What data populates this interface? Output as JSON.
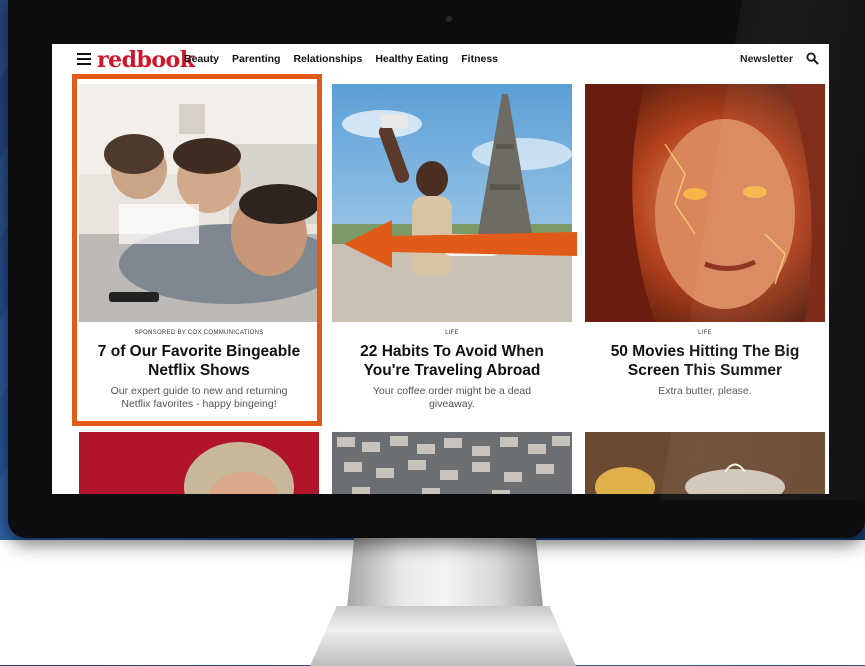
{
  "brand": {
    "logo_text": "redbook",
    "logo_color": "#d0152b"
  },
  "nav": {
    "links": [
      "Beauty",
      "Parenting",
      "Relationships",
      "Healthy Eating",
      "Fitness"
    ],
    "newsletter_label": "Newsletter"
  },
  "articles": [
    {
      "kicker": "SPONSORED BY COX COMMUNICATIONS",
      "title": "7 of Our Favorite Bingeable Netflix Shows",
      "dek": "Our expert guide to new and returning Netflix favorites - happy bingeing!"
    },
    {
      "kicker": "LIFE",
      "title": "22 Habits To Avoid When You're Traveling Abroad",
      "dek": "Your coffee order might be a dead giveaway."
    },
    {
      "kicker": "LIFE",
      "title": "50 Movies Hitting The Big Screen This Summer",
      "dek": "Extra butter, please."
    }
  ],
  "annotation": {
    "highlight_color": "#e15a17",
    "arrow_color": "#e15a17"
  }
}
